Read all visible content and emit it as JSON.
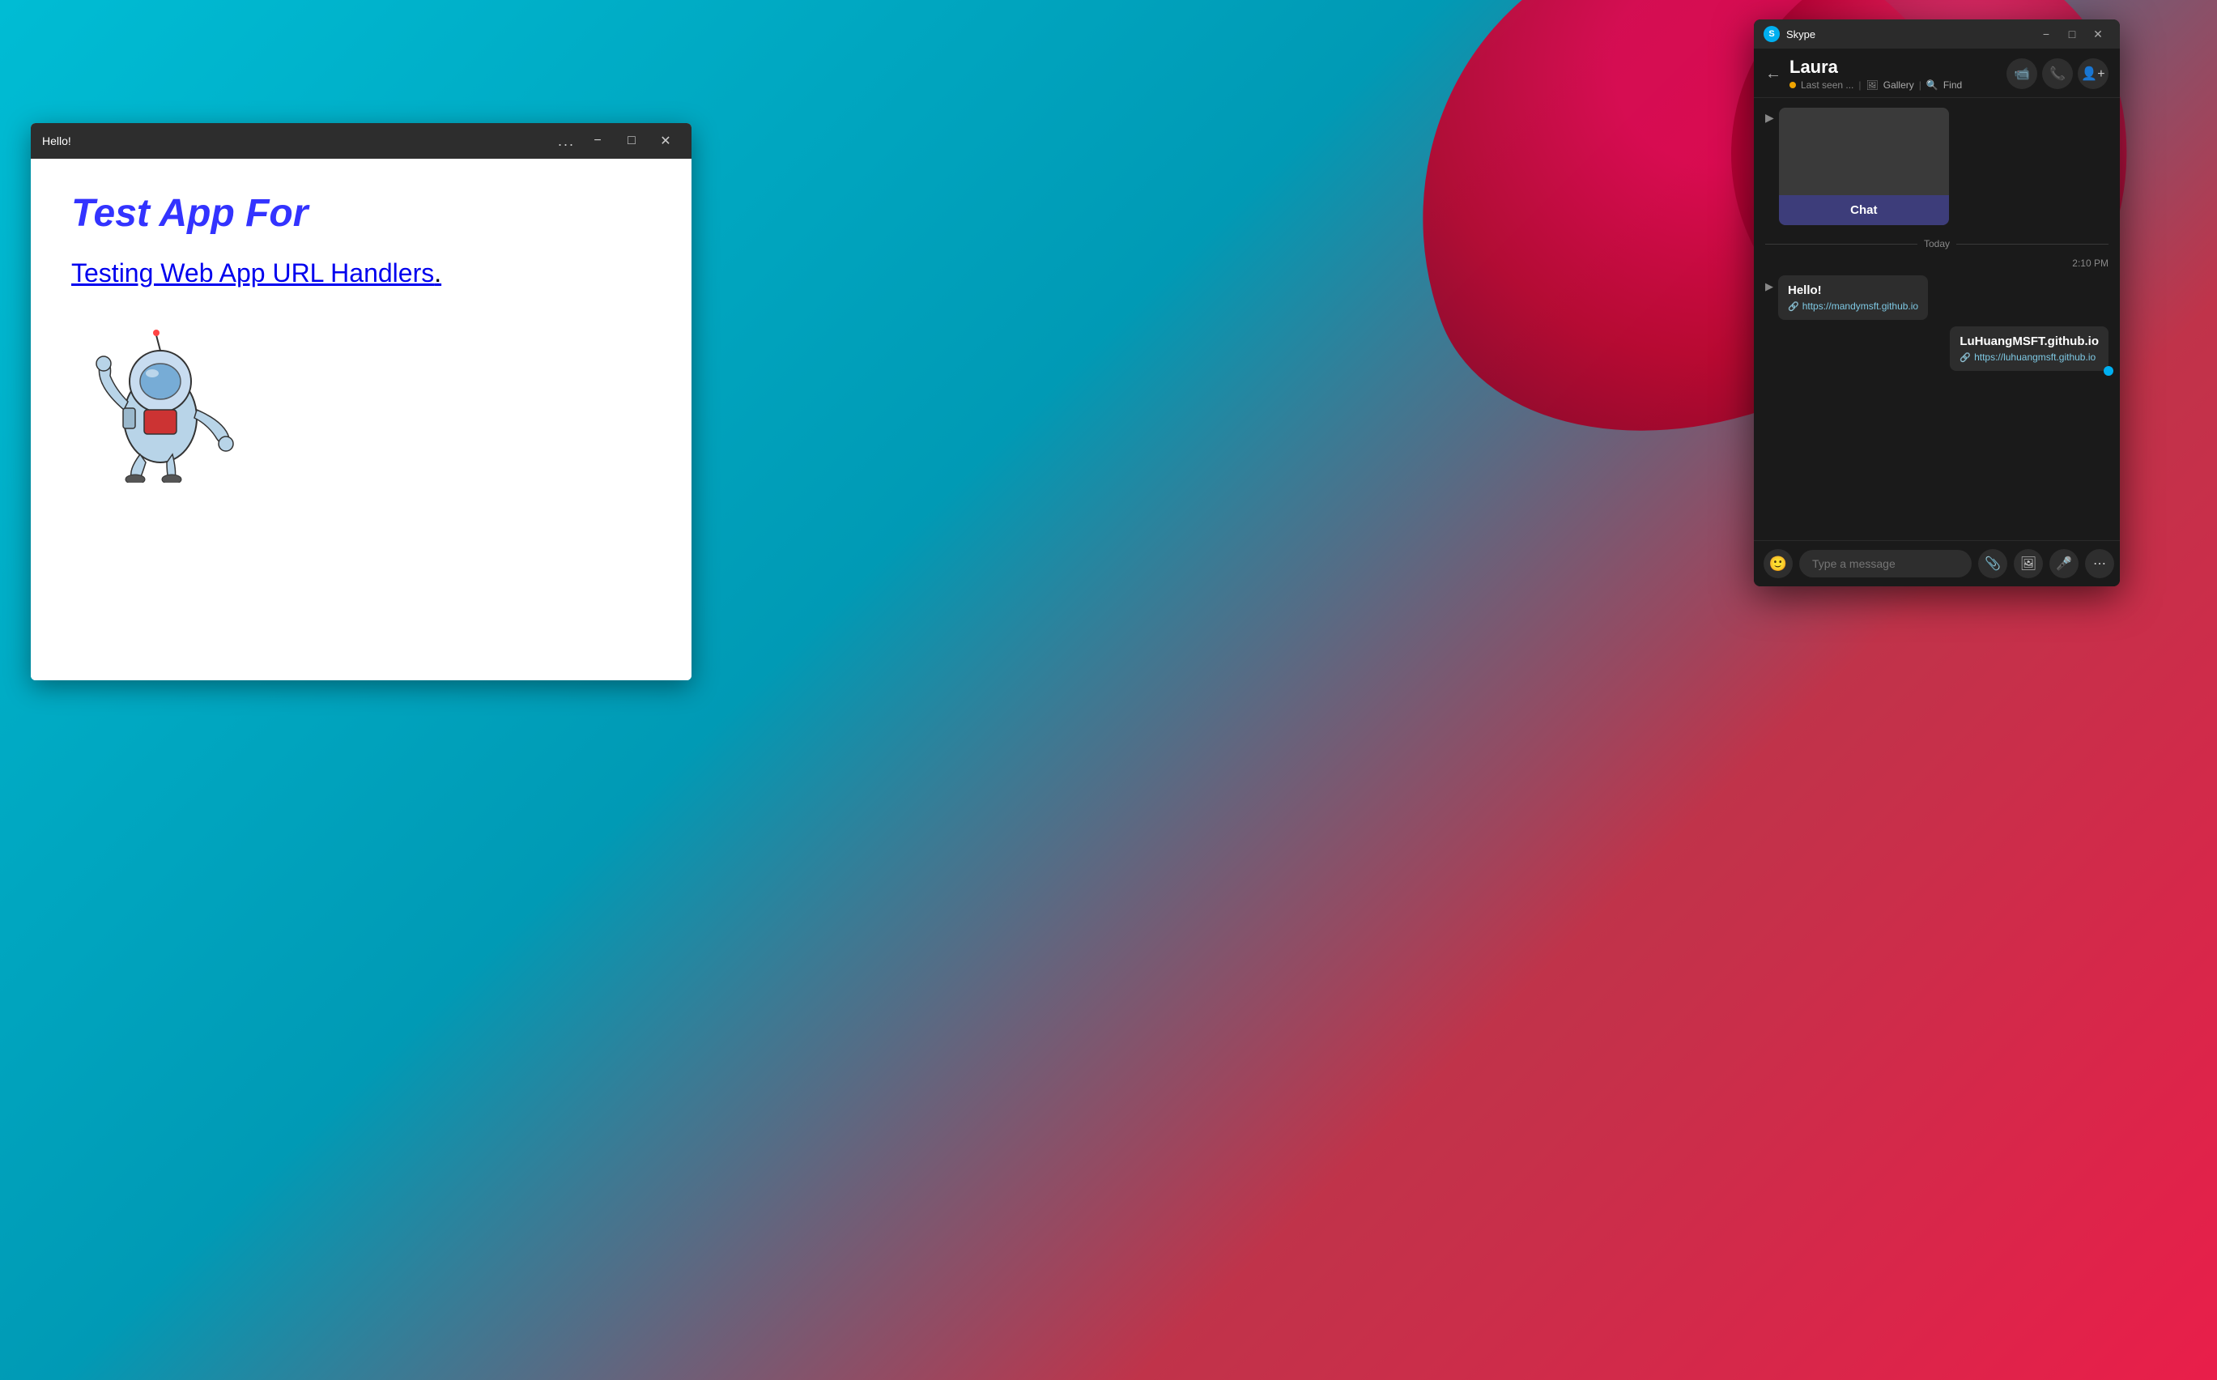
{
  "background": {
    "color1": "#00bcd4",
    "color2": "#e91e4a"
  },
  "hello_window": {
    "title": "Hello!",
    "title_label": "Hello!",
    "content_heading": "Test App For",
    "link_text": "Testing Web App URL Handlers",
    "controls": {
      "dots": "...",
      "minimize": "−",
      "maximize": "□",
      "close": "✕"
    }
  },
  "skype_window": {
    "app_title": "Skype",
    "controls": {
      "minimize": "−",
      "maximize": "□",
      "close": "✕"
    },
    "header": {
      "contact_name": "Laura",
      "status": "Last seen ...",
      "gallery": "Gallery",
      "find": "Find",
      "back_arrow": "←"
    },
    "chat_card": {
      "label": "Chat"
    },
    "today_divider": "Today",
    "message_time": "2:10 PM",
    "messages": [
      {
        "text": "Hello!",
        "link": "https://mandymsft.github.io"
      },
      {
        "text": "LuHuangMSFT.github.io",
        "link": "https://luhuangmsft.github.io"
      }
    ],
    "input": {
      "placeholder": "Type a message"
    },
    "toolbar": {
      "emoji_icon": "🙂",
      "file_icon": "📎",
      "image_icon": "🖼",
      "mic_icon": "🎤",
      "more_icon": "⋯"
    }
  }
}
